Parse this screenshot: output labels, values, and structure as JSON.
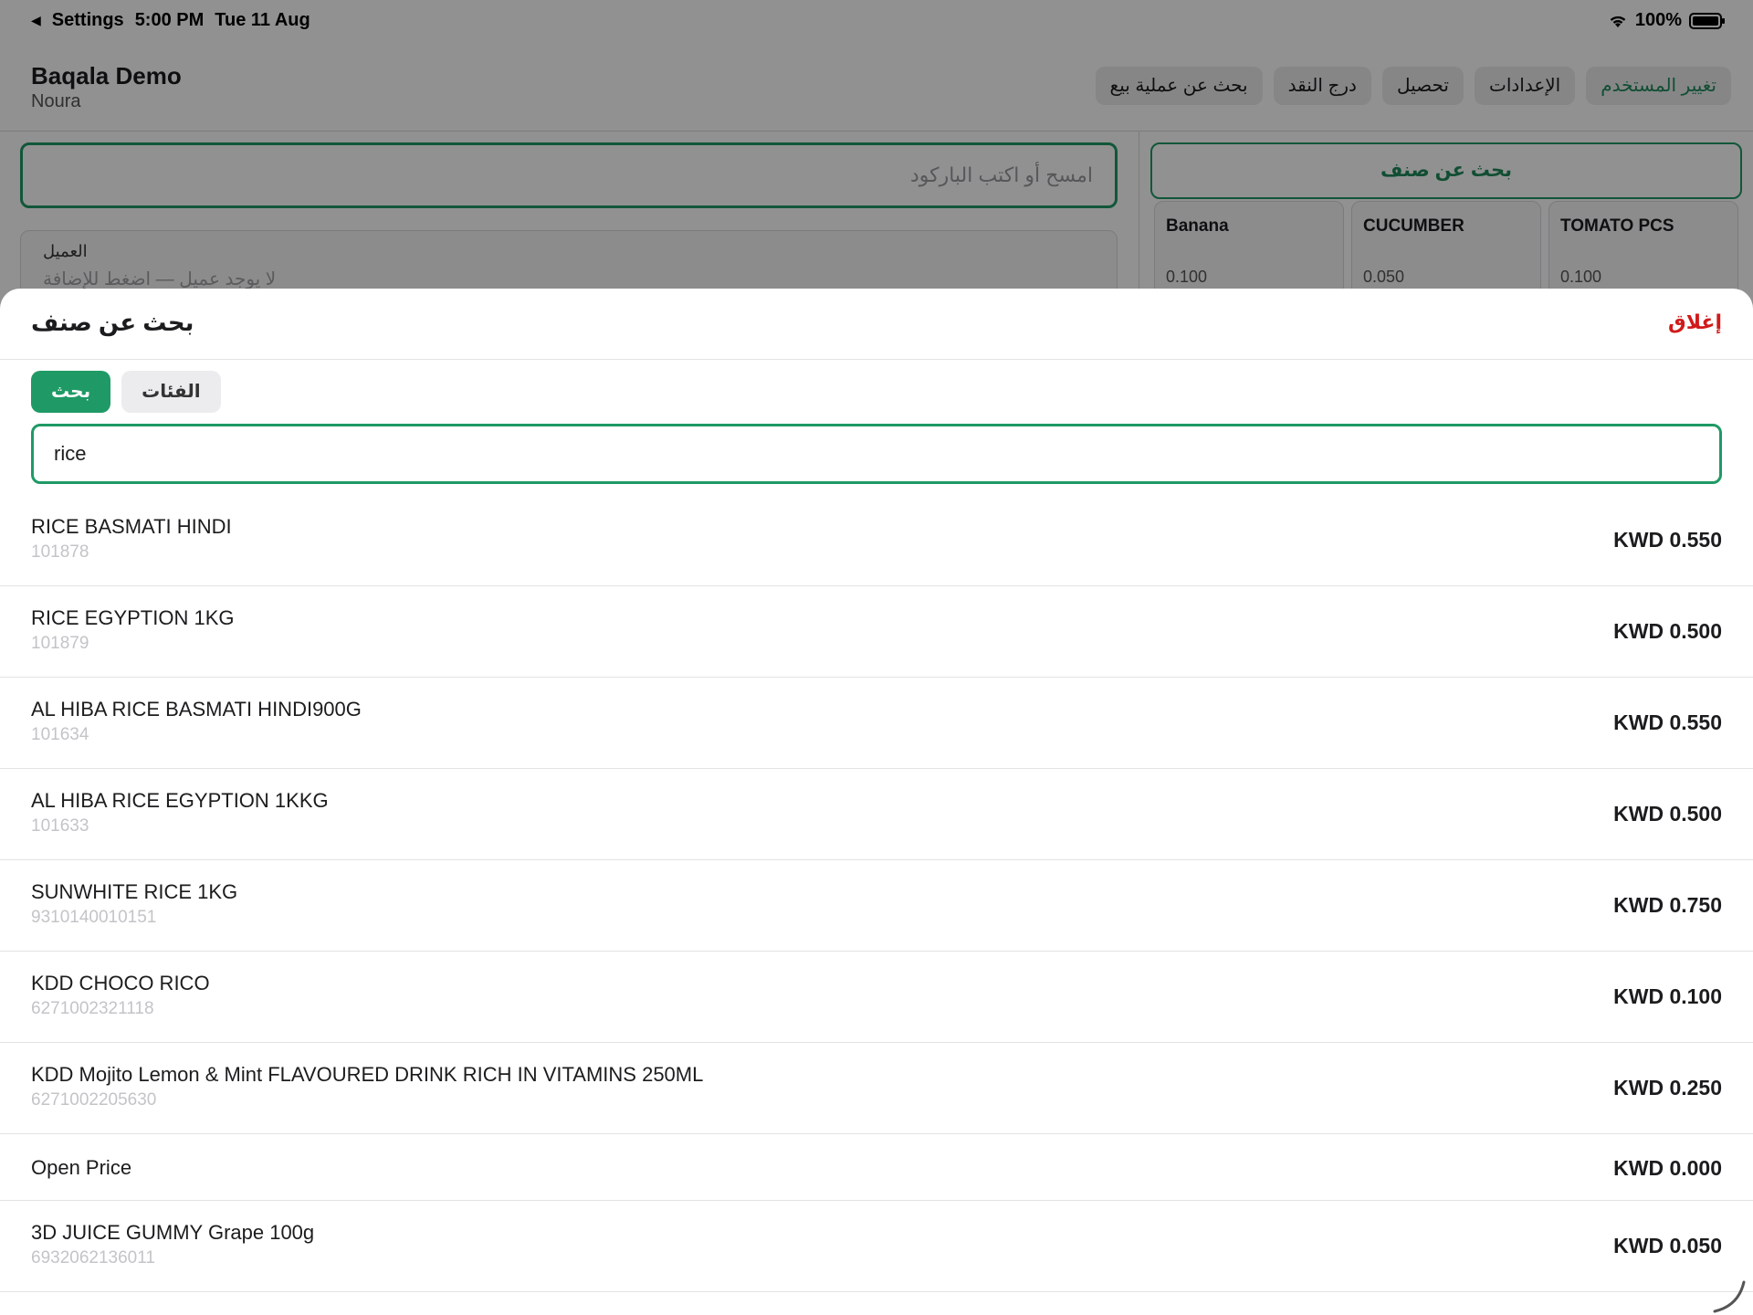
{
  "status_bar": {
    "back_label": "Settings",
    "time": "5:00 PM",
    "date": "Tue 11 Aug",
    "battery": "100%"
  },
  "header": {
    "store_name": "Baqala Demo",
    "user_name": "Noura",
    "buttons": [
      "تغيير المستخدم",
      "الإعدادات",
      "تحصيل",
      "درج النقد",
      "بحث عن عملية بيع"
    ]
  },
  "left_pane": {
    "barcode_placeholder": "امسح أو اكتب الباركود",
    "customer_label": "العميل",
    "customer_hint": "لا يوجد عميل — اضغط للإضافة"
  },
  "right_pane": {
    "item_search_label": "بحث عن صنف",
    "quick_items": [
      {
        "name": "Banana",
        "price": "0.100"
      },
      {
        "name": "CUCUMBER",
        "price": "0.050"
      },
      {
        "name": "TOMATO PCS",
        "price": "0.100"
      }
    ]
  },
  "modal": {
    "title": "بحث عن صنف",
    "close_label": "إغلاق",
    "tabs": {
      "search": "بحث",
      "categories": "الفئات"
    },
    "search_value": "rice",
    "results": [
      {
        "name": "RICE BASMATI HINDI",
        "code": "101878",
        "price": "KWD 0.550"
      },
      {
        "name": "RICE EGYPTION 1KG",
        "code": "101879",
        "price": "KWD 0.500"
      },
      {
        "name": "AL HIBA RICE BASMATI HINDI900G",
        "code": "101634",
        "price": "KWD 0.550"
      },
      {
        "name": "AL HIBA RICE EGYPTION 1KKG",
        "code": "101633",
        "price": "KWD 0.500"
      },
      {
        "name": "SUNWHITE RICE 1KG",
        "code": "9310140010151",
        "price": "KWD 0.750"
      },
      {
        "name": "KDD CHOCO RICO",
        "code": "6271002321118",
        "price": "KWD 0.100"
      },
      {
        "name": "KDD Mojito Lemon & Mint FLAVOURED DRINK RICH IN VITAMINS 250ML",
        "code": "6271002205630",
        "price": "KWD 0.250"
      },
      {
        "name": "Open Price",
        "code": "",
        "price": "KWD 0.000"
      },
      {
        "name": "3D JUICE GUMMY Grape 100g",
        "code": "6932062136011",
        "price": "KWD 0.050"
      }
    ]
  },
  "colors": {
    "accent": "#1f9a66",
    "danger": "#d11a1a"
  }
}
